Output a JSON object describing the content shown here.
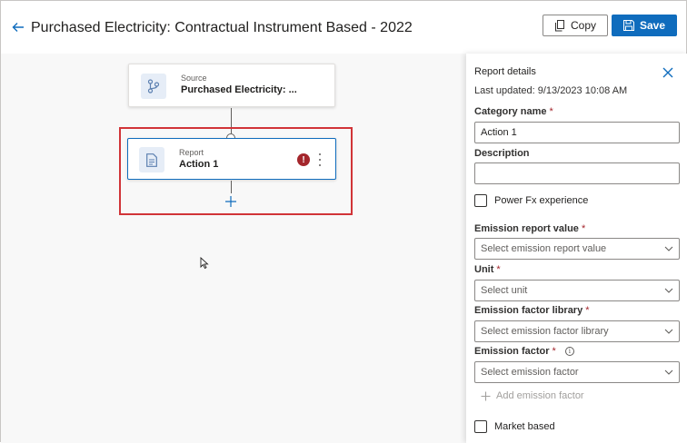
{
  "header": {
    "title": "Purchased Electricity: Contractual Instrument Based - 2022",
    "copy_label": "Copy",
    "save_label": "Save"
  },
  "canvas": {
    "source_node": {
      "kind": "Source",
      "name": "Purchased Electricity: ..."
    },
    "report_node": {
      "kind": "Report",
      "name": "Action 1",
      "error_glyph": "!"
    }
  },
  "panel": {
    "title": "Report details",
    "last_updated": "Last updated: 9/13/2023 10:08 AM",
    "category_name": {
      "label": "Category name",
      "required": "*",
      "value": "Action 1"
    },
    "description": {
      "label": "Description",
      "value": ""
    },
    "power_fx": {
      "label": "Power Fx experience"
    },
    "emission_report_value": {
      "label": "Emission report value",
      "required": "*",
      "placeholder": "Select emission report value"
    },
    "unit": {
      "label": "Unit",
      "required": "*",
      "placeholder": "Select unit"
    },
    "emission_factor_library": {
      "label": "Emission factor library",
      "required": "*",
      "placeholder": "Select emission factor library"
    },
    "emission_factor": {
      "label": "Emission factor",
      "required": "*",
      "info_glyph": "i",
      "placeholder": "Select emission factor"
    },
    "add_emission_factor": {
      "label": "Add emission factor"
    },
    "market_based": {
      "label": "Market based"
    }
  },
  "colors": {
    "accent": "#0f6cbd",
    "error": "#a4262c",
    "highlight": "#d13438"
  }
}
